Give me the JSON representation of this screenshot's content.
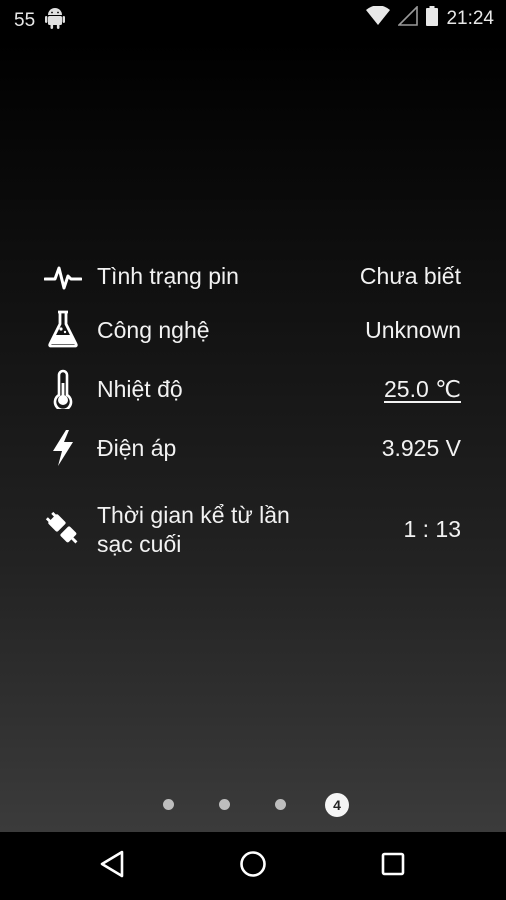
{
  "status_bar": {
    "notification_count": "55",
    "notification_icon": "android-icon",
    "wifi_icon": "wifi-icon",
    "signal_icon": "cell-signal-icon",
    "battery_icon": "battery-icon",
    "time": "21:24"
  },
  "battery_info": {
    "rows": [
      {
        "icon": "heartbeat-icon",
        "label": "Tình trạng pin",
        "value": "Chưa biết"
      },
      {
        "icon": "flask-icon",
        "label": "Công nghệ",
        "value": "Unknown"
      },
      {
        "icon": "thermometer-icon",
        "label": "Nhiệt độ",
        "value": "25.0 ℃"
      },
      {
        "icon": "lightning-icon",
        "label": "Điện áp",
        "value": "3.925 V"
      },
      {
        "icon": "plug-icon",
        "label_line1": "Thời gian kể từ lần",
        "label_line2": "sạc cuối",
        "value": "1 : 13"
      }
    ]
  },
  "pager": {
    "total_pages": 4,
    "current_page": "4"
  },
  "nav_bar": {
    "back_icon": "back-icon",
    "home_icon": "home-icon",
    "recents_icon": "recents-icon"
  }
}
